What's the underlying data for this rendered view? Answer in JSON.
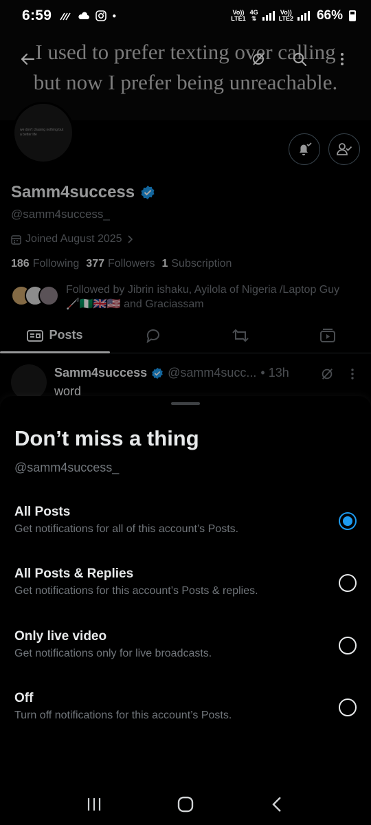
{
  "status_bar": {
    "time": "6:59",
    "net1_top": "Vo))",
    "net1_bottom": "LTE1",
    "net_4g": "4G",
    "net2_top": "Vo))",
    "net2_bottom": "LTE2",
    "battery": "66%"
  },
  "banner": {
    "line1": "I used to prefer texting over calling",
    "line2": "but now I prefer being unreachable."
  },
  "avatar_text": "we don't chasing nothing but a better life",
  "profile": {
    "name": "Samm4success",
    "handle": "@samm4success_",
    "joined": "Joined August 2025",
    "following_count": "186",
    "following_label": "Following",
    "followers_count": "377",
    "followers_label": "Followers",
    "subscription_count": "1",
    "subscription_label": "Subscription",
    "followed_by": "Followed by Jibrin ishaku, Ayilola of Nigeria /Laptop Guy 🦯🇳🇬🇬🇧🇺🇸 and Graciassam"
  },
  "tabs": {
    "posts": "Posts"
  },
  "post": {
    "name": "Samm4success",
    "handle": "@samm4succ...",
    "time": "• 13h",
    "text": "word"
  },
  "sheet": {
    "title": "Don’t miss a thing",
    "handle": "@samm4success_",
    "options": [
      {
        "label": "All Posts",
        "desc": "Get notifications for all of this account’s Posts.",
        "selected": true
      },
      {
        "label": "All Posts & Replies",
        "desc": "Get notifications for this account’s Posts & replies.",
        "selected": false
      },
      {
        "label": "Only live video",
        "desc": "Get notifications only for live broadcasts.",
        "selected": false
      },
      {
        "label": "Off",
        "desc": "Turn off notifications for this account’s Posts.",
        "selected": false
      }
    ]
  },
  "colors": {
    "accent": "#1d9bf0",
    "text_primary": "#e7e9ea",
    "text_secondary": "#71767b"
  }
}
